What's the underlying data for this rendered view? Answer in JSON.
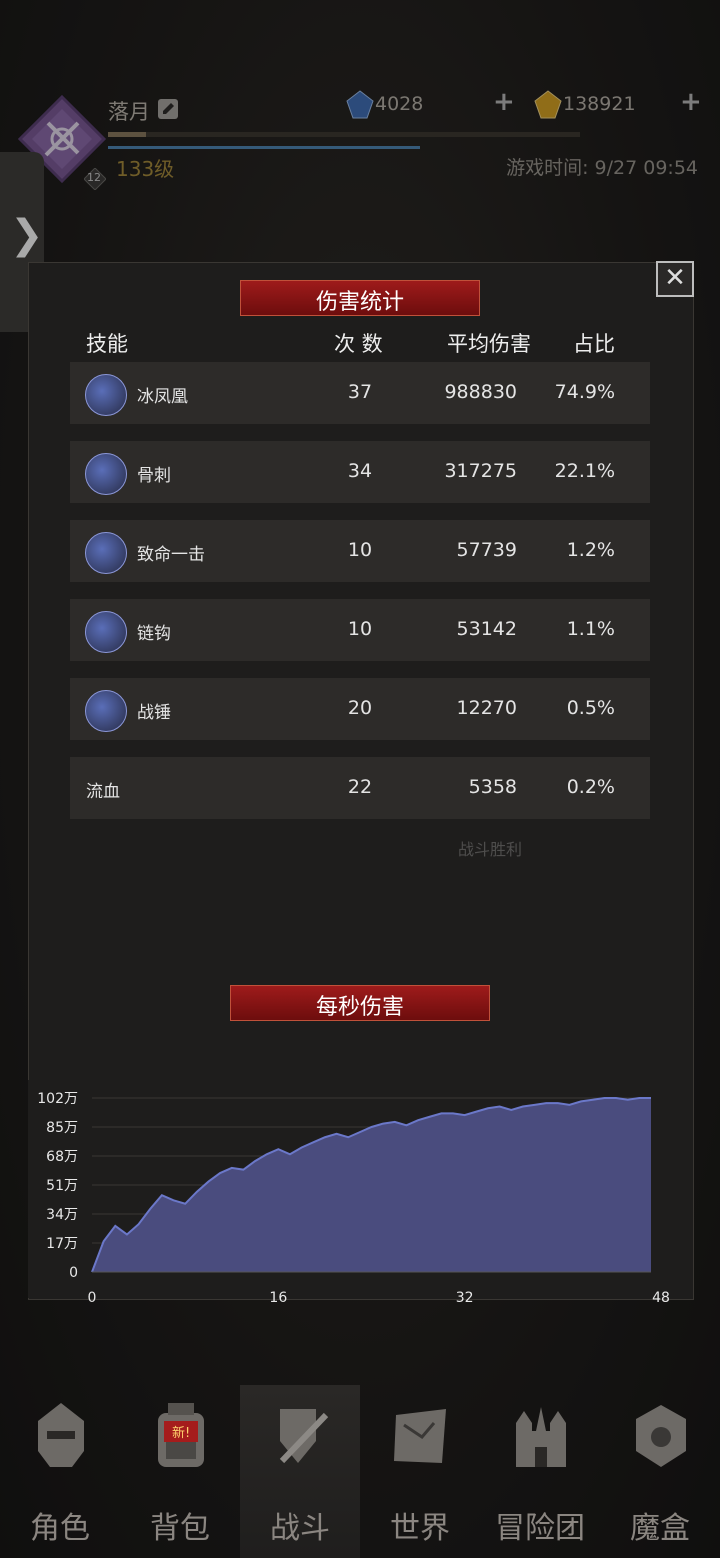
{
  "header": {
    "name": "落月",
    "level": "133级",
    "level_badge": "12",
    "xp_progress": 0.08,
    "mp_progress": 0.66,
    "crystal": "4028",
    "gold": "138921",
    "game_time": "游戏时间: 9/27 09:54"
  },
  "side_tab_arrow": "❯",
  "modal": {
    "title": "伤害统计",
    "close_glyph": "✕",
    "columns": [
      "技能",
      "次 数",
      "平均伤害",
      "占比"
    ],
    "rows": [
      {
        "name": "冰凤凰",
        "count": "37",
        "avg": "988830",
        "pct": "74.9%",
        "icon": "ice-phoenix-icon"
      },
      {
        "name": "骨刺",
        "count": "34",
        "avg": "317275",
        "pct": "22.1%",
        "icon": "bone-spike-icon"
      },
      {
        "name": "致命一击",
        "count": "10",
        "avg": "57739",
        "pct": "1.2%",
        "icon": "critical-strike-icon"
      },
      {
        "name": "链钩",
        "count": "10",
        "avg": "53142",
        "pct": "1.1%",
        "icon": "chain-hook-icon"
      },
      {
        "name": "战锤",
        "count": "20",
        "avg": "12270",
        "pct": "0.5%",
        "icon": "war-hammer-icon"
      },
      {
        "name": "流血",
        "count": "22",
        "avg": "5358",
        "pct": "0.2%",
        "icon": ""
      }
    ],
    "battle_result": "战斗胜利",
    "dps_title": "每秒伤害"
  },
  "chart_data": {
    "type": "area",
    "x": [
      0,
      1,
      2,
      3,
      4,
      5,
      6,
      7,
      8,
      9,
      10,
      11,
      12,
      13,
      14,
      15,
      16,
      17,
      18,
      19,
      20,
      21,
      22,
      23,
      24,
      25,
      26,
      27,
      28,
      29,
      30,
      31,
      32,
      33,
      34,
      35,
      36,
      37,
      38,
      39,
      40,
      41,
      42,
      43,
      44,
      45,
      46,
      47,
      48
    ],
    "values": [
      0,
      18,
      27,
      22,
      28,
      37,
      45,
      42,
      40,
      47,
      53,
      58,
      61,
      60,
      65,
      69,
      72,
      69,
      73,
      76,
      79,
      81,
      79,
      82,
      85,
      87,
      88,
      86,
      89,
      91,
      93,
      93,
      92,
      94,
      96,
      97,
      95,
      97,
      98,
      99,
      99,
      98,
      100,
      101,
      102,
      102,
      101,
      102,
      102
    ],
    "y_unit": "万",
    "yticks": [
      "0",
      "17万",
      "34万",
      "51万",
      "68万",
      "85万",
      "102万"
    ],
    "ytick_values": [
      0,
      17,
      34,
      51,
      68,
      85,
      102
    ],
    "xticks": [
      "0",
      "16",
      "32",
      "48"
    ],
    "xtick_values": [
      0,
      16,
      32,
      48
    ],
    "ylim": [
      0,
      102
    ],
    "xlim": [
      0,
      48
    ],
    "fill_color": "#4a4c7e",
    "line_color": "#6b78c9"
  },
  "nav": [
    {
      "label": "角色",
      "icon": "helmet-icon",
      "active": false
    },
    {
      "label": "背包",
      "icon": "backpack-icon",
      "active": false,
      "badge": "新!"
    },
    {
      "label": "战斗",
      "icon": "sword-shield-icon",
      "active": true
    },
    {
      "label": "世界",
      "icon": "map-scroll-icon",
      "active": false
    },
    {
      "label": "冒险团",
      "icon": "castle-icon",
      "active": false
    },
    {
      "label": "魔盒",
      "icon": "cube-icon",
      "active": false
    }
  ]
}
